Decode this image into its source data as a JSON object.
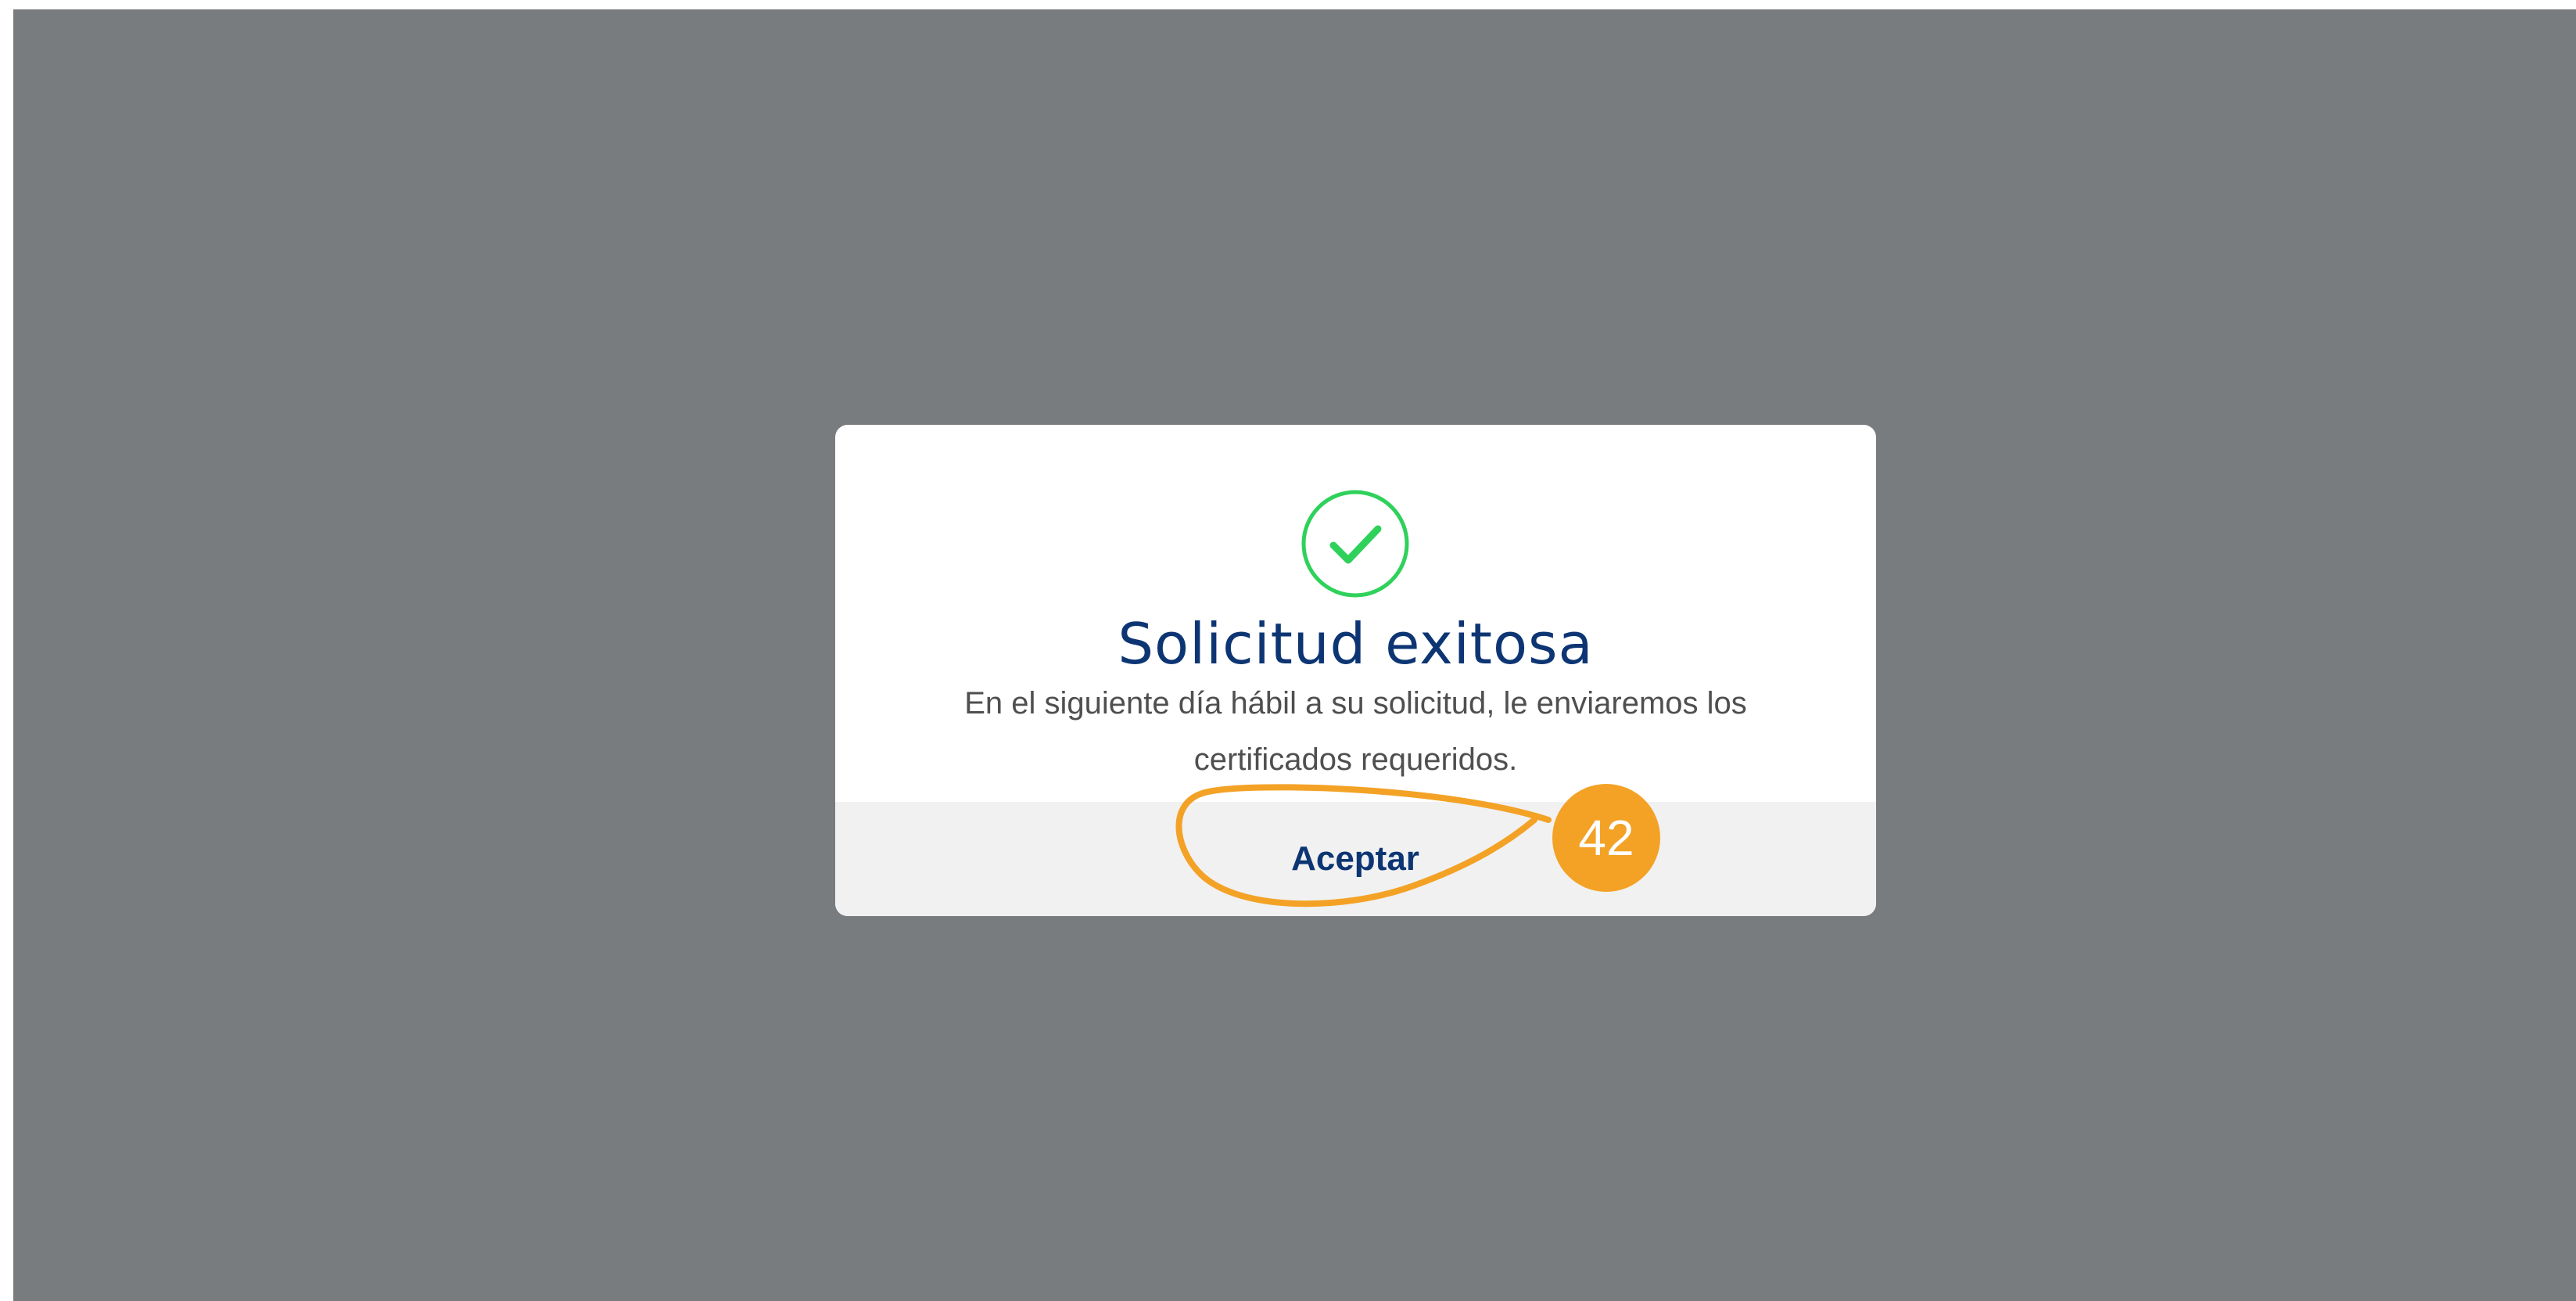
{
  "dialog": {
    "icon": "check-circle-icon",
    "title": "Solicitud exitosa",
    "message": "En el siguiente día hábil a su solicitud, le enviaremos los certificados requeridos.",
    "accept_label": "Aceptar"
  },
  "annotation": {
    "step_number": "42"
  },
  "colors": {
    "overlay": "#797c7e",
    "title": "#0d3573",
    "success": "#2fd15b",
    "annotation": "#f3a226"
  }
}
